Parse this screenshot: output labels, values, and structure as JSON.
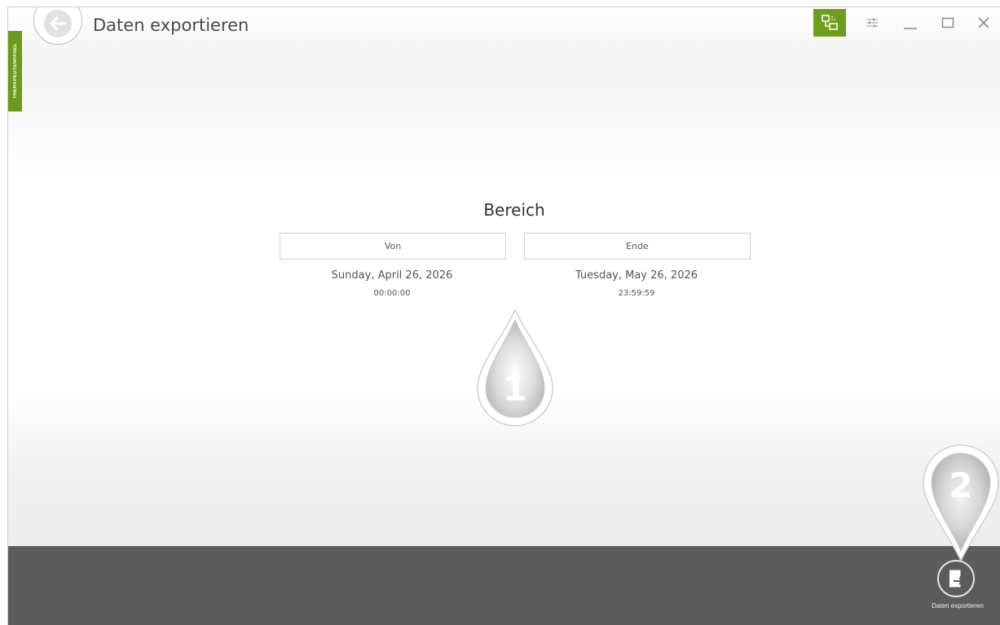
{
  "window": {
    "title": "Daten exportieren",
    "side_tab_label": "THERAPEUTENPANEL",
    "accent_color": "#6f9e1e",
    "bottom_bar_color": "#5c5c5c"
  },
  "toolbar": {
    "buttons": [
      {
        "icon": "network-devices-icon",
        "active": true
      },
      {
        "icon": "settings-sliders-icon",
        "active": false
      },
      {
        "icon": "minimize-icon",
        "active": false
      },
      {
        "icon": "maximize-icon",
        "active": false
      },
      {
        "icon": "close-icon",
        "active": false
      }
    ]
  },
  "range": {
    "heading": "Bereich",
    "from": {
      "label": "Von",
      "date": "Sunday, April 26, 2026",
      "time": "00:00:00"
    },
    "to": {
      "label": "Ende",
      "date": "Tuesday, May 26, 2026",
      "time": "23:59:59"
    }
  },
  "markers": {
    "first": "1",
    "second": "2"
  },
  "footer": {
    "export_label": "Daten exportieren",
    "export_icon": "export-document-icon"
  }
}
